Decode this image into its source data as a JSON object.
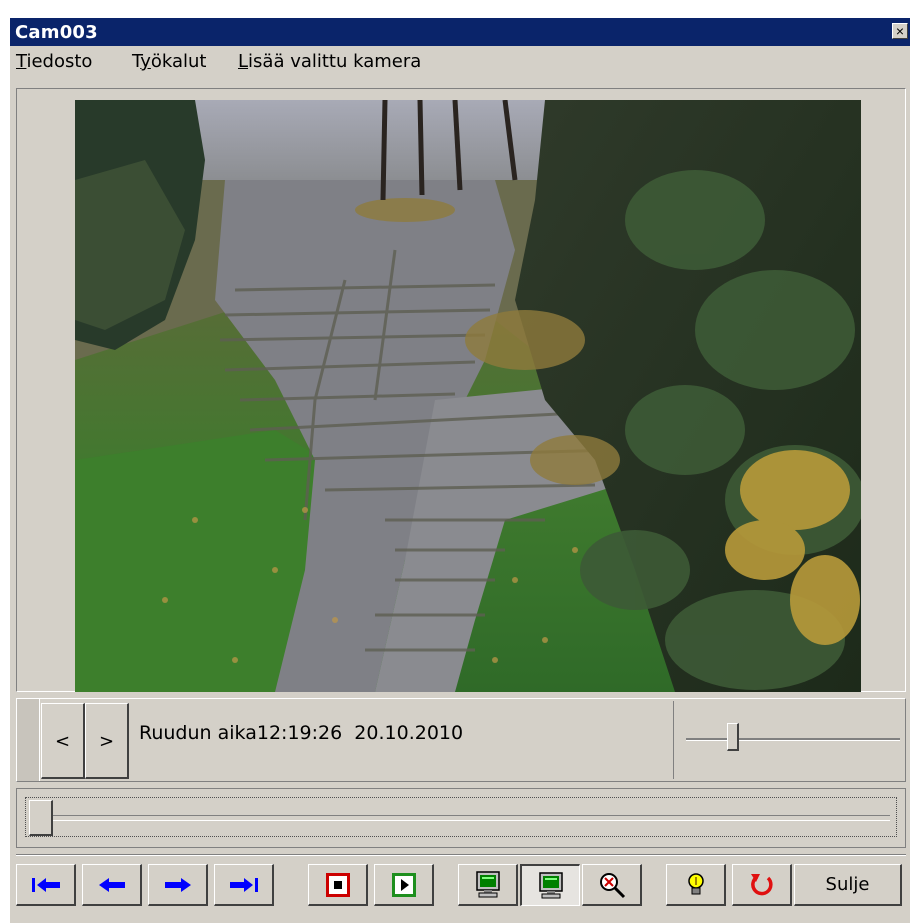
{
  "window": {
    "title": "Cam003",
    "close_glyph": "×"
  },
  "menu": [
    {
      "label": "Tiedosto",
      "accel": "T",
      "rest": "iedosto"
    },
    {
      "label": "Työkalut",
      "accel": "y",
      "pre": "T",
      "rest": "ökalut"
    },
    {
      "label": "Lisää valittu kamera",
      "accel": "L",
      "rest": "isää valittu kamera"
    }
  ],
  "navigation": {
    "prev_label": "<",
    "next_label": ">",
    "frame_time_label": "Ruudun aika",
    "frame_time": "12:19:26",
    "frame_date": "20.10.2010"
  },
  "speed_slider_level": 0.22,
  "timeline_position": 0.0,
  "toolbar": {
    "buttons": [
      {
        "icon": "skip-to-first-icon"
      },
      {
        "icon": "step-back-icon"
      },
      {
        "icon": "step-forward-icon"
      },
      {
        "icon": "skip-to-last-icon"
      },
      {
        "icon": "stop-icon"
      },
      {
        "icon": "play-icon"
      },
      {
        "icon": "monitor-icon"
      },
      {
        "icon": "monitor-icon",
        "pressed": true
      },
      {
        "icon": "zoom-icon"
      },
      {
        "icon": "lightbulb-icon"
      },
      {
        "icon": "refresh-icon"
      }
    ],
    "close_label": "Sulje"
  },
  "colors": {
    "title_bar": "#0a246a",
    "window_bg": "#d4d0c8",
    "nav_arrow_blue": "#0000ff",
    "stop_red": "#cc0000",
    "play_green": "#1e8f1e",
    "refresh_red": "#e01010",
    "bulb_yellow": "#ffff00"
  }
}
